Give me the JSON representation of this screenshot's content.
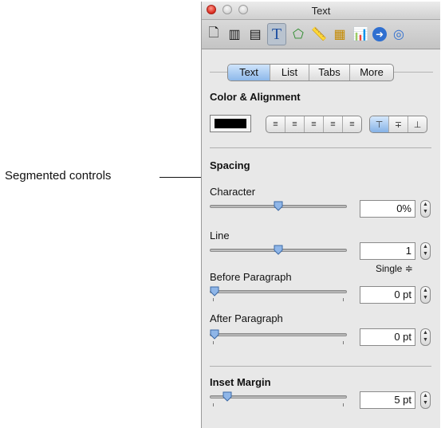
{
  "callout": {
    "label": "Segmented controls"
  },
  "window": {
    "title": "Text"
  },
  "toolbar": {
    "buttons": [
      {
        "icon": "document-icon",
        "glyph": "🗋"
      },
      {
        "icon": "layout-icon",
        "glyph": "▥"
      },
      {
        "icon": "wrap-icon",
        "glyph": "▤"
      },
      {
        "icon": "text-icon",
        "glyph": "T"
      },
      {
        "icon": "graphic-icon",
        "glyph": "⬠"
      },
      {
        "icon": "metrics-icon",
        "glyph": "📏"
      },
      {
        "icon": "table-icon",
        "glyph": "▦"
      },
      {
        "icon": "chart-icon",
        "glyph": "📊"
      },
      {
        "icon": "link-icon",
        "glyph": "➜"
      },
      {
        "icon": "quicktime-icon",
        "glyph": "◎"
      }
    ]
  },
  "tabs": [
    {
      "label": "Text"
    },
    {
      "label": "List"
    },
    {
      "label": "Tabs"
    },
    {
      "label": "More"
    }
  ],
  "sections": {
    "color_alignment": "Color & Alignment",
    "spacing": "Spacing",
    "inset_margin": "Inset Margin"
  },
  "alignment": {
    "horizontal": [
      "≡",
      "≡",
      "≡",
      "≡",
      "≡"
    ],
    "vertical": [
      "⊤",
      "∓",
      "⊥"
    ]
  },
  "colors": {
    "text_color": "#000000",
    "accent": "#86b2e6"
  },
  "spacing": {
    "character": {
      "label": "Character",
      "value": "0%",
      "level": 0.5
    },
    "line": {
      "label": "Line",
      "value": "1",
      "level": 0.5,
      "mode": "Single ≑"
    },
    "before_paragraph": {
      "label": "Before Paragraph",
      "value": "0 pt",
      "level": 0
    },
    "after_paragraph": {
      "label": "After Paragraph",
      "value": "0 pt",
      "level": 0
    }
  },
  "inset_margin": {
    "value": "5 pt",
    "level": 0.1
  }
}
